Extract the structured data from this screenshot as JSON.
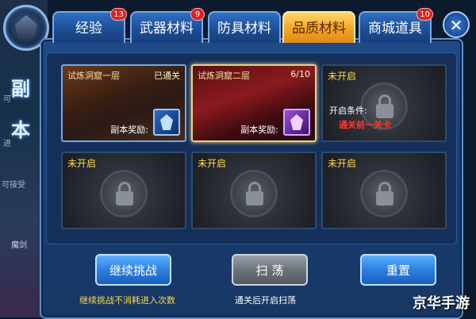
{
  "sidebar": {
    "title_char_1": "副",
    "title_char_2": "本",
    "text_1": "可",
    "text_2": "进",
    "text_3": "可接受",
    "text_4": "魔剑"
  },
  "tabs": [
    {
      "label": "经验",
      "badge": "13",
      "active": false
    },
    {
      "label": "武器材料",
      "badge": "9",
      "active": false
    },
    {
      "label": "防具材料",
      "badge": "",
      "active": false
    },
    {
      "label": "品质材料",
      "badge": "",
      "active": true
    },
    {
      "label": "商城道具",
      "badge": "10",
      "active": false
    }
  ],
  "close_icon": "✕",
  "dungeons": [
    {
      "title": "试炼洞窟一层",
      "status": "已通关",
      "reward_label": "副本奖励:",
      "reward_icon": "blue-crystal-icon",
      "locked": false
    },
    {
      "title": "试炼洞窟二层",
      "status": "6/10",
      "reward_label": "副本奖励:",
      "reward_icon": "purple-crystal-icon",
      "locked": false
    },
    {
      "locked_label": "未开启",
      "unlock_condition_label": "开启条件:",
      "unlock_requirement": "通关前一关卡",
      "locked": true
    },
    {
      "locked_label": "未开启",
      "locked": true
    },
    {
      "locked_label": "未开启",
      "locked": true
    },
    {
      "locked_label": "未开启",
      "locked": true
    }
  ],
  "actions": {
    "continue_label": "继续挑战",
    "continue_hint": "继续挑战不消耗进入次数",
    "sweep_label": "扫  荡",
    "sweep_hint": "通关后开启扫荡",
    "reset_label": "重置"
  },
  "watermark": "京华手游",
  "colors": {
    "active_tab": "#f2a42a",
    "tab": "#1d4e95",
    "hint_yellow": "#ffd84a",
    "requirement_red": "#ff3a2a"
  }
}
